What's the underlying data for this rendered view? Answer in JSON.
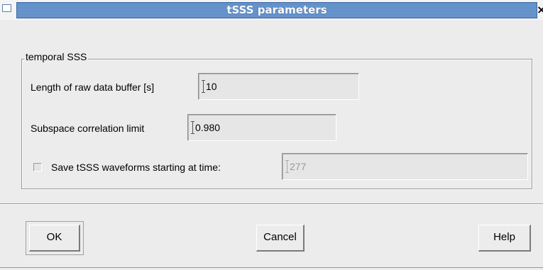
{
  "window": {
    "title": "tSSS parameters",
    "close_glyph": "×"
  },
  "group": {
    "label": "temporal SSS"
  },
  "fields": {
    "buffer_label": "Length of raw data buffer [s]",
    "buffer_value": "10",
    "corr_label": "Subspace correlation limit",
    "corr_value": "0.980",
    "save_label": "Save tSSS waveforms starting at time:",
    "save_value": "277",
    "save_checked": false
  },
  "buttons": {
    "ok": "OK",
    "cancel": "Cancel",
    "help": "Help"
  },
  "colors": {
    "titlebar": "#5b8ac4",
    "background": "#ececec"
  }
}
